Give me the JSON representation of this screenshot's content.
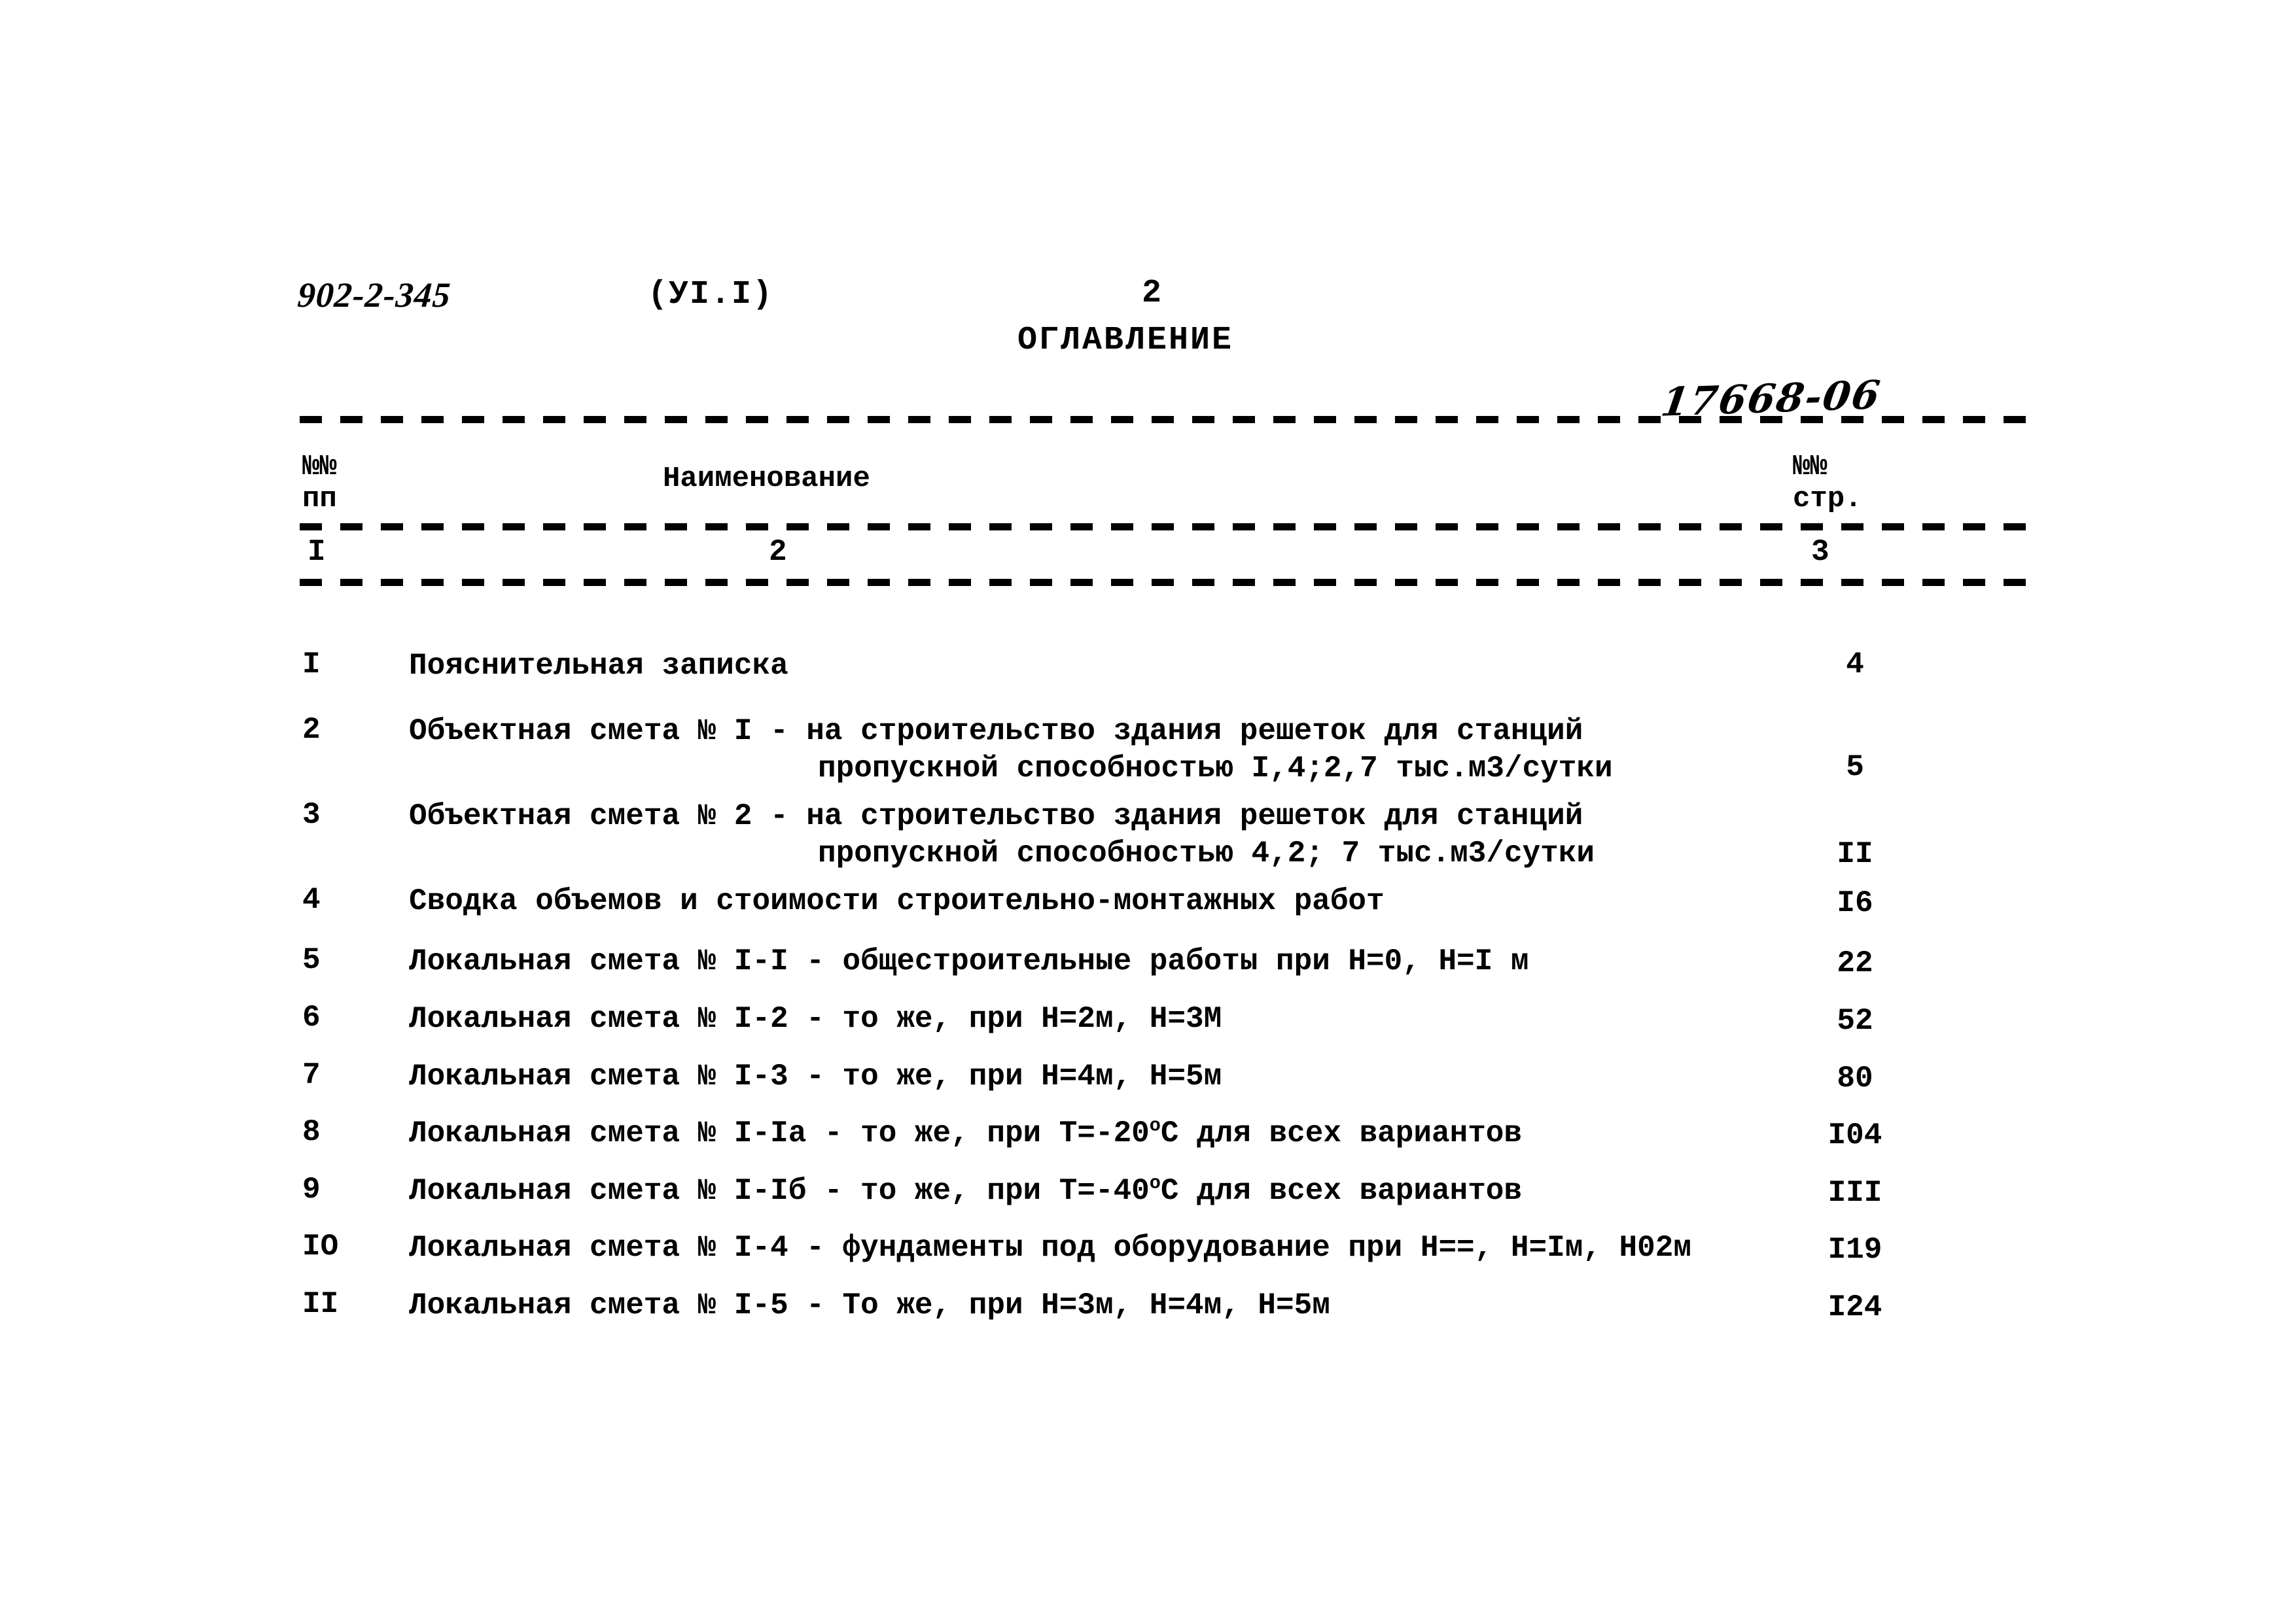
{
  "header": {
    "doc_code": "902-2-345",
    "section": "(УI.I)",
    "page_number": "2",
    "title": "ОГЛАВЛЕНИЕ",
    "archive_number": "17668-06"
  },
  "table": {
    "col_num_header": "№№\nпп",
    "col_name_header": "Наименование",
    "col_page_header": "№№\nстр.",
    "col_index_1": "I",
    "col_index_2": "2",
    "col_index_3": "3",
    "rows": [
      {
        "num": "I",
        "name_line1": "Пояснительная записка",
        "name_line2": "",
        "page": "4"
      },
      {
        "num": "2",
        "name_line1": "Объектная смета № I - на строительство здания решеток для станций",
        "name_line2": "пропускной способностью I,4;2,7 тыс.м3/сутки",
        "page": "5"
      },
      {
        "num": "3",
        "name_line1": "Объектная смета № 2 - на строительство здания решеток для станций",
        "name_line2": "пропускной способностью 4,2; 7 тыс.м3/сутки",
        "page": "II"
      },
      {
        "num": "4",
        "name_line1": "Сводка объемов и стоимости строительно-монтажных работ",
        "name_line2": "",
        "page": "I6"
      },
      {
        "num": "5",
        "name_line1": "Локальная смета № I-I - общестроительные работы при Н=0, Н=I м",
        "name_line2": "",
        "page": "22"
      },
      {
        "num": "6",
        "name_line1": "Локальная смета № I-2 - то же, при Н=2м, Н=3М",
        "name_line2": "",
        "page": "52"
      },
      {
        "num": "7",
        "name_line1": "Локальная смета № I-3 - то же, при Н=4м, Н=5м",
        "name_line2": "",
        "page": "80"
      },
      {
        "num": "8",
        "name_line1": "Локальная смета № I-Iа - то же, при Т=-20°С для всех вариантов",
        "name_line2": "",
        "page": "I04"
      },
      {
        "num": "9",
        "name_line1": "Локальная смета № I-Iб - то же, при Т=-40°С для всех вариантов",
        "name_line2": "",
        "page": "III"
      },
      {
        "num": "IO",
        "name_line1": "Локальная смета № I-4 - фундаменты под оборудование при Н==, Н=Iм, Н02м",
        "name_line2": "",
        "page": "I19"
      },
      {
        "num": "II",
        "name_line1": "Локальная смета № I-5 - То же, при Н=3м, Н=4м, Н=5м",
        "name_line2": "",
        "page": "I24"
      }
    ]
  }
}
